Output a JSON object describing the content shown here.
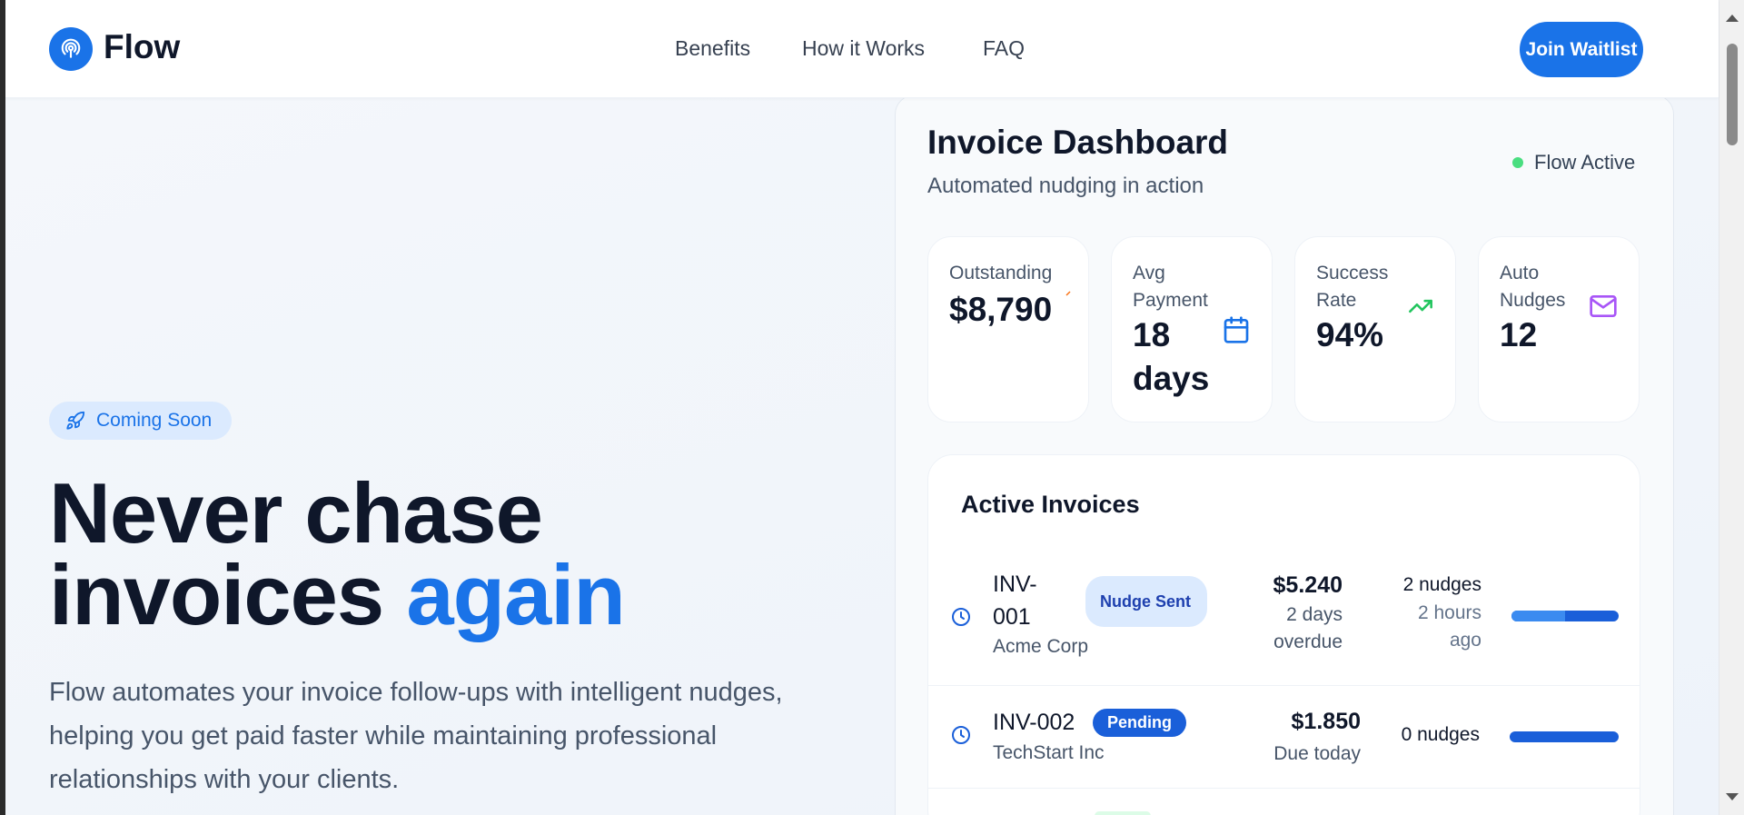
{
  "header": {
    "brand": "Flow",
    "nav": [
      "Benefits",
      "How it Works",
      "FAQ"
    ],
    "cta": "Join Waitlist"
  },
  "hero": {
    "badge": "Coming Soon",
    "title_line1": "Never chase",
    "title_line2": "invoices",
    "title_accent": "again",
    "description": "Flow automates your invoice follow-ups with intelligent nudges, helping you get paid faster while maintaining professional relationships with your clients."
  },
  "dashboard": {
    "title": "Invoice Dashboard",
    "subtitle": "Automated nudging in action",
    "status": "Flow Active",
    "stats": [
      {
        "label": "Outstanding",
        "value": "$8,790",
        "icon": "dollar-icon"
      },
      {
        "label": "Avg Payment",
        "value": "18 days",
        "icon": "calendar-icon"
      },
      {
        "label": "Success Rate",
        "value": "94%",
        "icon": "trending-up-icon"
      },
      {
        "label": "Auto Nudges",
        "value": "12",
        "icon": "mail-icon"
      }
    ],
    "invoices_title": "Active Invoices",
    "invoices": [
      {
        "id": "INV-001",
        "client": "Acme Corp",
        "status": "Nudge Sent",
        "amount": "$5.240",
        "due": "2 days overdue",
        "nudges": "2 nudges",
        "last": "2 hours ago",
        "progress": 0.5
      },
      {
        "id": "INV-002",
        "client": "TechStart Inc",
        "status": "Pending",
        "amount": "$1.850",
        "due": "Due today",
        "nudges": "0 nudges",
        "last": "",
        "progress": 0
      }
    ]
  },
  "colors": {
    "brand": "#1a73e8",
    "text": "#0f172a",
    "muted": "#475569",
    "status_active": "#4ade80"
  }
}
